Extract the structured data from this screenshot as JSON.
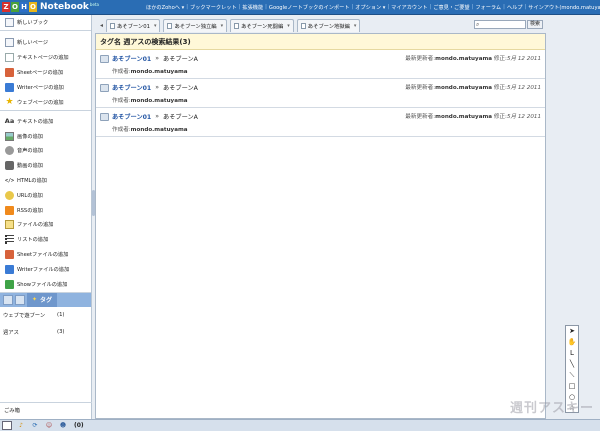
{
  "app": {
    "logo_letters": [
      "Z",
      "O",
      "H",
      "O"
    ],
    "logo_letter_colors": [
      "#d6312f",
      "#4aa13b",
      "#2c6fc6",
      "#e9b61b"
    ],
    "logo_name": "Notebook",
    "logo_beta": "beta"
  },
  "topnav": [
    "ほかのZohoへ ▾",
    "ブックマークレット",
    "拡張機能",
    "Googleノートブックのインポート",
    "オプション ▾",
    "マイアカウント",
    "ご意見・ご要望",
    "フォーラム",
    "ヘルプ",
    "サインアウト(mondo.matuyama)"
  ],
  "sidebar": {
    "new_book": "新しいブック",
    "page_items": [
      {
        "icon": "blank-page-icon",
        "label": "新しいページ"
      },
      {
        "icon": "text-page-icon",
        "label": "テキストページの追加"
      },
      {
        "icon": "sheet-page-icon",
        "label": "Sheetページの追加"
      },
      {
        "icon": "writer-page-icon",
        "label": "Writerページの追加"
      },
      {
        "icon": "web-page-icon",
        "label": "ウェブページの追加"
      }
    ],
    "content_items": [
      {
        "icon": "text-icon",
        "glyph": "Aa",
        "label": "テキストの追加"
      },
      {
        "icon": "image-icon",
        "glyph": "",
        "label": "画像の追加"
      },
      {
        "icon": "audio-icon",
        "glyph": "",
        "label": "音声の追加"
      },
      {
        "icon": "video-icon",
        "glyph": "",
        "label": "動画の追加"
      },
      {
        "icon": "html-icon",
        "glyph": "</>",
        "label": "HTMLの追加"
      },
      {
        "icon": "url-icon",
        "glyph": "",
        "label": "URLの追加"
      },
      {
        "icon": "rss-icon",
        "glyph": "",
        "label": "RSSの追加"
      },
      {
        "icon": "file-icon",
        "glyph": "",
        "label": "ファイルの追加"
      },
      {
        "icon": "list-icon",
        "glyph": "",
        "label": "リストの追加"
      },
      {
        "icon": "sheet-file-icon",
        "glyph": "",
        "label": "Sheetファイルの追加"
      },
      {
        "icon": "writer-file-icon",
        "glyph": "",
        "label": "Writerファイルの追加"
      },
      {
        "icon": "show-file-icon",
        "glyph": "",
        "label": "Showファイルの追加"
      }
    ],
    "tag_tab": "タグ",
    "tags": [
      {
        "name": "ウェブで遊ブーン",
        "count": "(1)"
      },
      {
        "name": "週アス",
        "count": "(3)"
      }
    ],
    "trash": "ごみ箱"
  },
  "tabs": [
    {
      "label": "あそブーン01"
    },
    {
      "label": "あそブーン独立編"
    },
    {
      "label": "あそブーン死闘編"
    },
    {
      "label": "あそブーン地獄編"
    }
  ],
  "search": {
    "placeholder": "",
    "button": "検索"
  },
  "results": {
    "heading": "タグ名 週アスの検索結果(3)",
    "items": [
      {
        "book": "あそブーン01",
        "arrow": "»",
        "page": "あそブーンA",
        "updated_label": "最新更新者:",
        "updated_by": "mondo.matuyama",
        "modified_label": "修正:",
        "modified": "5月 12 2011",
        "author_label": "作成者:",
        "author": "mondo.matuyama"
      },
      {
        "book": "あそブーン01",
        "arrow": "»",
        "page": "あそブーンA",
        "updated_label": "最新更新者:",
        "updated_by": "mondo.matuyama",
        "modified_label": "修正:",
        "modified": "5月 12 2011",
        "author_label": "作成者:",
        "author": "mondo.matuyama"
      },
      {
        "book": "あそブーン01",
        "arrow": "»",
        "page": "あそブーンA",
        "updated_label": "最新更新者:",
        "updated_by": "mondo.matuyama",
        "modified_label": "修正:",
        "modified": "5月 12 2011",
        "author_label": "作成者:",
        "author": "mondo.matuyama"
      }
    ]
  },
  "palette": [
    {
      "name": "pointer-tool-icon",
      "glyph": "➤"
    },
    {
      "name": "hand-tool-icon",
      "glyph": "✋"
    },
    {
      "name": "elbow-line-tool-icon",
      "glyph": "L"
    },
    {
      "name": "line-tool-icon",
      "glyph": "╲"
    },
    {
      "name": "curve-tool-icon",
      "glyph": "⟍"
    },
    {
      "name": "rectangle-tool-icon",
      "glyph": "□"
    },
    {
      "name": "ellipse-tool-icon",
      "glyph": "○"
    },
    {
      "name": "star-tool-icon",
      "glyph": "☆"
    }
  ],
  "watermark": "週刊アスキー",
  "bottombar": {
    "count": "(0)"
  },
  "colors": {
    "topbar": "#2a6db4",
    "link": "#2456a4",
    "result_header": "#fff8d8"
  }
}
